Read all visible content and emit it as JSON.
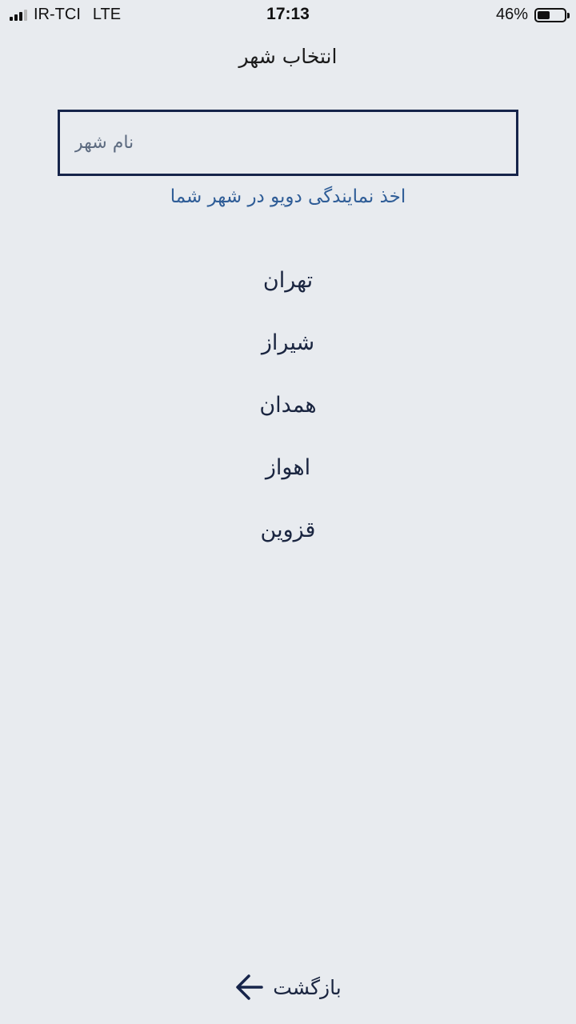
{
  "status_bar": {
    "carrier": "IR-TCI",
    "network": "LTE",
    "time": "17:13",
    "battery_percent": "46%",
    "battery_level": 0.46,
    "signal_bars": 3
  },
  "header": {
    "title": "انتخاب شهر"
  },
  "search": {
    "placeholder": "نام شهر",
    "value": ""
  },
  "agency_link": {
    "label": "اخذ نمایندگی دویو در شهر شما"
  },
  "cities": [
    {
      "label": "تهران"
    },
    {
      "label": "شیراز"
    },
    {
      "label": "همدان"
    },
    {
      "label": "اهواز"
    },
    {
      "label": "قزوین"
    }
  ],
  "footer": {
    "back_label": "بازگشت",
    "back_icon": "arrow-left-icon"
  },
  "colors": {
    "background": "#e8ebef",
    "primary": "#16244a",
    "link": "#2f5d97"
  }
}
